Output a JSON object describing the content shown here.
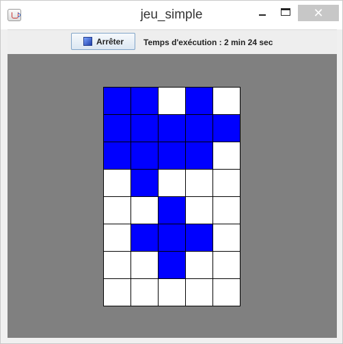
{
  "window": {
    "title": "jeu_simple",
    "close_glyph": "✕",
    "icons": [
      "java-icon",
      "minimize-icon",
      "maximize-icon",
      "close-icon"
    ]
  },
  "toolbar": {
    "stop_label": "Arrêter",
    "stop_icon": "blue-square-icon",
    "time_label": "Temps d'exécution : 2 min 24 sec"
  },
  "board": {
    "rows": 8,
    "cols": 5,
    "filled_color": "#0000ff",
    "empty_color": "#ffffff",
    "background_color": "#808080",
    "cells": [
      [
        1,
        1,
        0,
        1,
        0
      ],
      [
        1,
        1,
        1,
        1,
        1
      ],
      [
        1,
        1,
        1,
        1,
        0
      ],
      [
        0,
        1,
        0,
        0,
        0
      ],
      [
        0,
        0,
        1,
        0,
        0
      ],
      [
        0,
        1,
        1,
        1,
        0
      ],
      [
        0,
        0,
        1,
        0,
        0
      ],
      [
        0,
        0,
        0,
        0,
        0
      ]
    ]
  }
}
